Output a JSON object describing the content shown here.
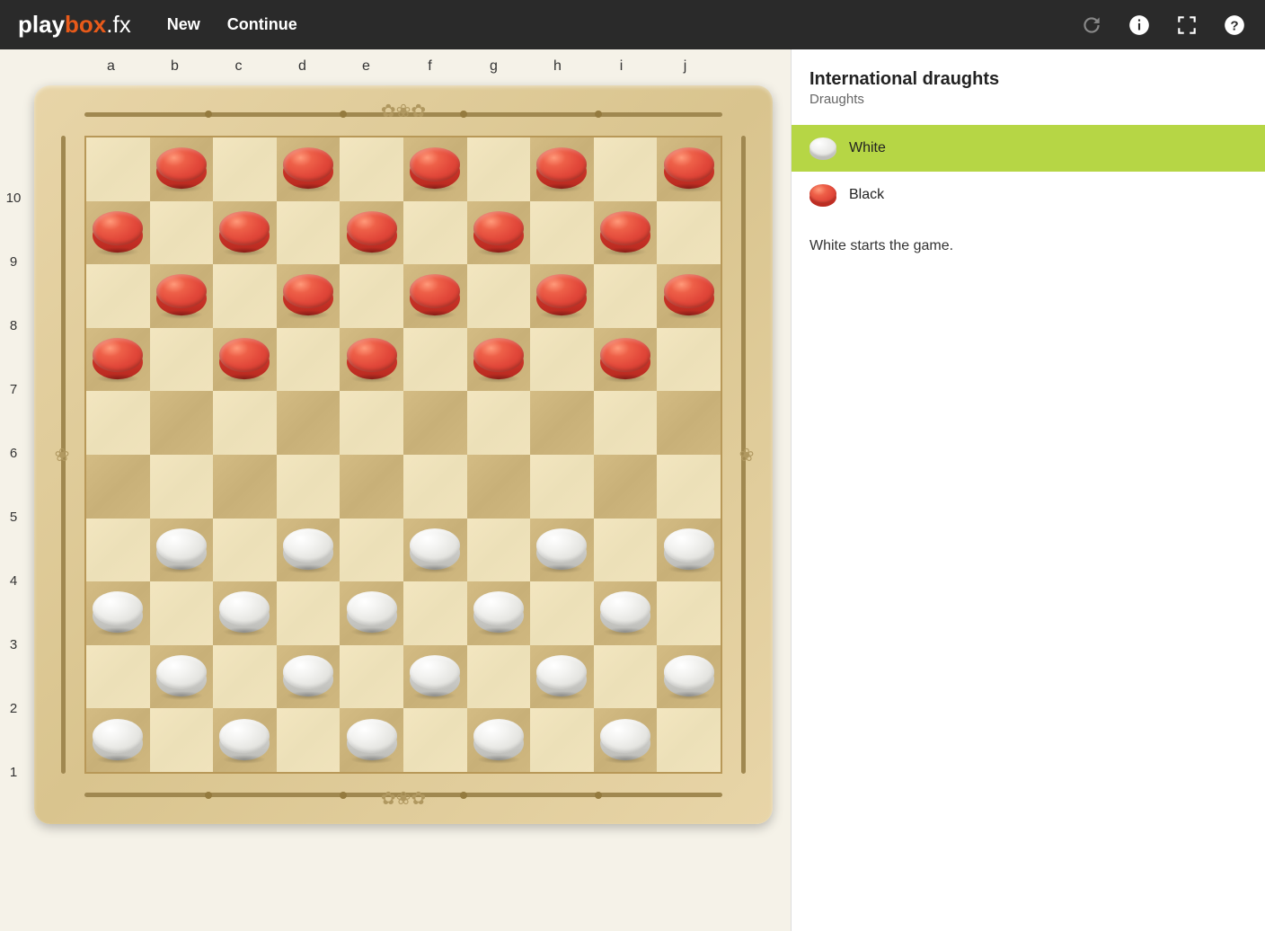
{
  "logo": {
    "play": "play",
    "box": "box",
    "fx": ".fx"
  },
  "nav": {
    "new": "New",
    "continue": "Continue"
  },
  "board": {
    "cols": [
      "a",
      "b",
      "c",
      "d",
      "e",
      "f",
      "g",
      "h",
      "i",
      "j"
    ],
    "rows": [
      "10",
      "9",
      "8",
      "7",
      "6",
      "5",
      "4",
      "3",
      "2",
      "1"
    ],
    "pieces": [
      {
        "row": 10,
        "col": "b",
        "color": "red"
      },
      {
        "row": 10,
        "col": "d",
        "color": "red"
      },
      {
        "row": 10,
        "col": "f",
        "color": "red"
      },
      {
        "row": 10,
        "col": "h",
        "color": "red"
      },
      {
        "row": 10,
        "col": "j",
        "color": "red"
      },
      {
        "row": 9,
        "col": "a",
        "color": "red"
      },
      {
        "row": 9,
        "col": "c",
        "color": "red"
      },
      {
        "row": 9,
        "col": "e",
        "color": "red"
      },
      {
        "row": 9,
        "col": "g",
        "color": "red"
      },
      {
        "row": 9,
        "col": "i",
        "color": "red"
      },
      {
        "row": 8,
        "col": "b",
        "color": "red"
      },
      {
        "row": 8,
        "col": "d",
        "color": "red"
      },
      {
        "row": 8,
        "col": "f",
        "color": "red"
      },
      {
        "row": 8,
        "col": "h",
        "color": "red"
      },
      {
        "row": 8,
        "col": "j",
        "color": "red"
      },
      {
        "row": 7,
        "col": "a",
        "color": "red"
      },
      {
        "row": 7,
        "col": "c",
        "color": "red"
      },
      {
        "row": 7,
        "col": "e",
        "color": "red"
      },
      {
        "row": 7,
        "col": "g",
        "color": "red"
      },
      {
        "row": 7,
        "col": "i",
        "color": "red"
      },
      {
        "row": 4,
        "col": "b",
        "color": "white"
      },
      {
        "row": 4,
        "col": "d",
        "color": "white"
      },
      {
        "row": 4,
        "col": "f",
        "color": "white"
      },
      {
        "row": 4,
        "col": "h",
        "color": "white"
      },
      {
        "row": 4,
        "col": "j",
        "color": "white"
      },
      {
        "row": 3,
        "col": "a",
        "color": "white"
      },
      {
        "row": 3,
        "col": "c",
        "color": "white"
      },
      {
        "row": 3,
        "col": "e",
        "color": "white"
      },
      {
        "row": 3,
        "col": "g",
        "color": "white"
      },
      {
        "row": 3,
        "col": "i",
        "color": "white"
      },
      {
        "row": 2,
        "col": "b",
        "color": "white"
      },
      {
        "row": 2,
        "col": "d",
        "color": "white"
      },
      {
        "row": 2,
        "col": "f",
        "color": "white"
      },
      {
        "row": 2,
        "col": "h",
        "color": "white"
      },
      {
        "row": 2,
        "col": "j",
        "color": "white"
      },
      {
        "row": 1,
        "col": "a",
        "color": "white"
      },
      {
        "row": 1,
        "col": "c",
        "color": "white"
      },
      {
        "row": 1,
        "col": "e",
        "color": "white"
      },
      {
        "row": 1,
        "col": "g",
        "color": "white"
      },
      {
        "row": 1,
        "col": "i",
        "color": "white"
      }
    ]
  },
  "sidebar": {
    "title": "International draughts",
    "subtitle": "Draughts",
    "players": [
      {
        "label": "White",
        "color": "white",
        "active": true
      },
      {
        "label": "Black",
        "color": "red",
        "active": false
      }
    ],
    "status": "White starts the game."
  }
}
